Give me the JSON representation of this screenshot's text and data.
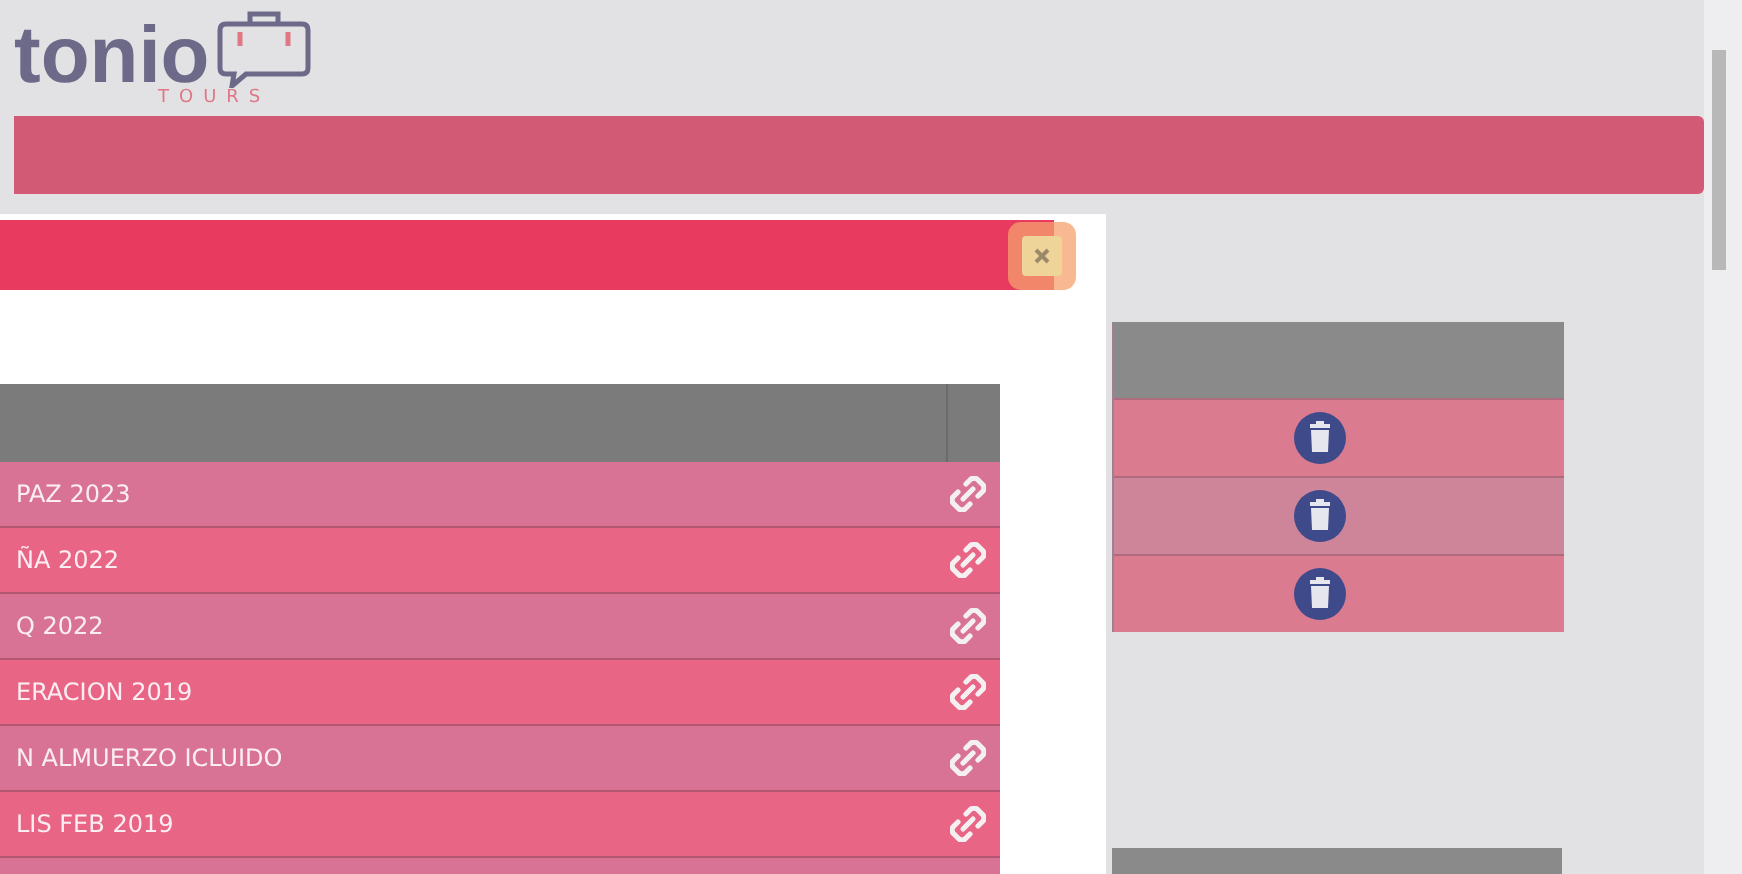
{
  "logo": {
    "name": "tonio",
    "tagline": "TOURS"
  },
  "background_table": {
    "rows": [
      {
        "kind": "delete"
      },
      {
        "kind": "delete"
      },
      {
        "kind": "delete"
      }
    ]
  },
  "modal": {
    "table": {
      "rows": [
        {
          "name": "PAZ 2023",
          "kind": "link"
        },
        {
          "name": "ÑA 2022",
          "kind": "link"
        },
        {
          "name": "Q 2022",
          "kind": "link"
        },
        {
          "name": "ERACION 2019",
          "kind": "link"
        },
        {
          "name": "N ALMUERZO ICLUIDO",
          "kind": "link"
        },
        {
          "name": "LIS FEB 2019",
          "kind": "link"
        }
      ]
    }
  }
}
